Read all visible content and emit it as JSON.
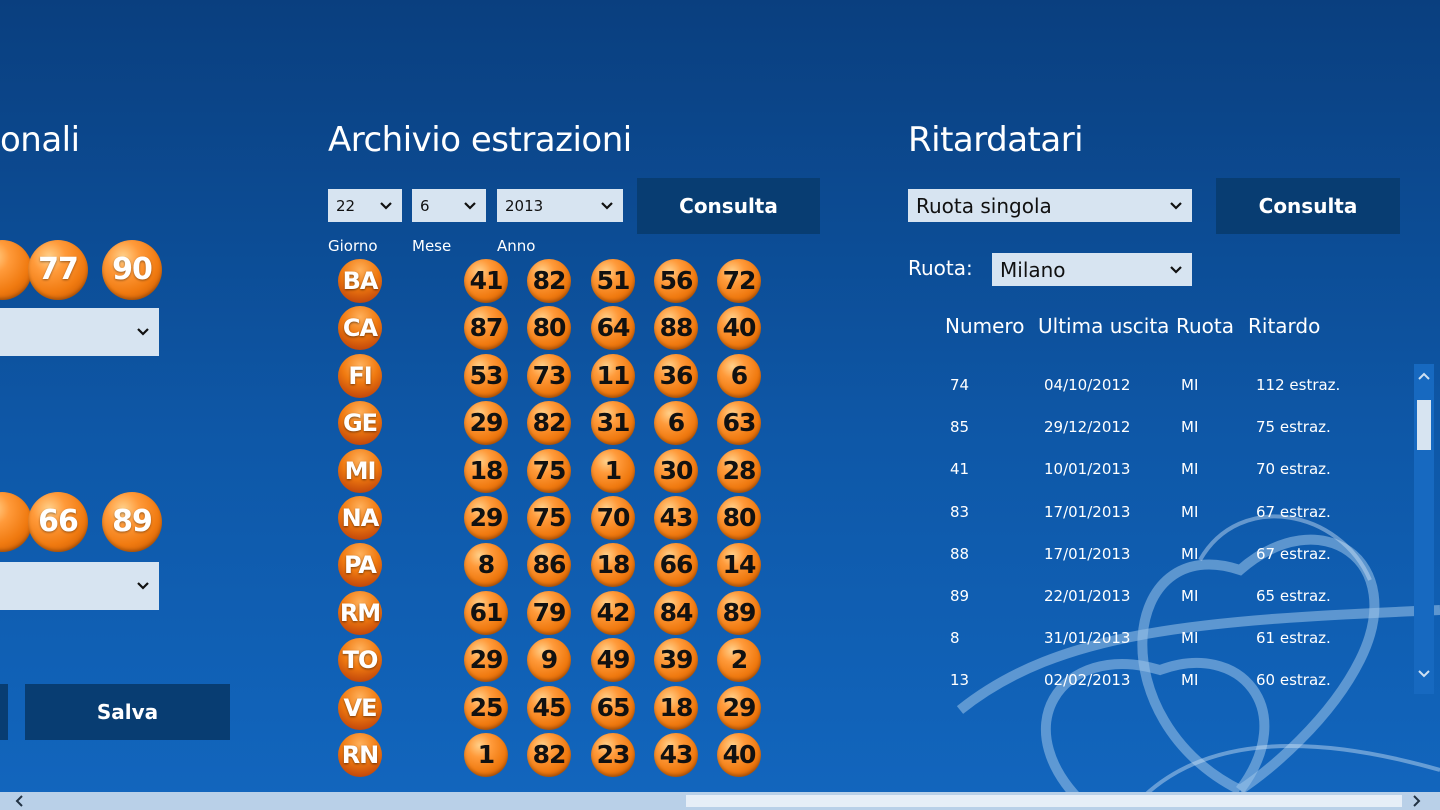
{
  "left": {
    "title_fragment": "onali",
    "balls_row1": [
      "77",
      "90"
    ],
    "balls_row2": [
      "66",
      "89"
    ],
    "salva_label": "Salva"
  },
  "archive": {
    "title": "Archivio estrazioni",
    "day": "22",
    "month": "6",
    "year": "2013",
    "consulta_label": "Consulta",
    "label_day": "Giorno",
    "label_month": "Mese",
    "label_year": "Anno",
    "rows": [
      {
        "city": "BA",
        "numbers": [
          "41",
          "82",
          "51",
          "56",
          "72"
        ]
      },
      {
        "city": "CA",
        "numbers": [
          "87",
          "80",
          "64",
          "88",
          "40"
        ]
      },
      {
        "city": "FI",
        "numbers": [
          "53",
          "73",
          "11",
          "36",
          "6"
        ]
      },
      {
        "city": "GE",
        "numbers": [
          "29",
          "82",
          "31",
          "6",
          "63"
        ]
      },
      {
        "city": "MI",
        "numbers": [
          "18",
          "75",
          "1",
          "30",
          "28"
        ]
      },
      {
        "city": "NA",
        "numbers": [
          "29",
          "75",
          "70",
          "43",
          "80"
        ]
      },
      {
        "city": "PA",
        "numbers": [
          "8",
          "86",
          "18",
          "66",
          "14"
        ]
      },
      {
        "city": "RM",
        "numbers": [
          "61",
          "79",
          "42",
          "84",
          "89"
        ]
      },
      {
        "city": "TO",
        "numbers": [
          "29",
          "9",
          "49",
          "39",
          "2"
        ]
      },
      {
        "city": "VE",
        "numbers": [
          "25",
          "45",
          "65",
          "18",
          "29"
        ]
      },
      {
        "city": "RN",
        "numbers": [
          "1",
          "82",
          "23",
          "43",
          "40"
        ]
      }
    ]
  },
  "ritardatari": {
    "title": "Ritardatari",
    "mode_value": "Ruota singola",
    "consulta_label": "Consulta",
    "ruota_label": "Ruota:",
    "ruota_value": "Milano",
    "headers": {
      "numero": "Numero",
      "ultima": "Ultima uscita",
      "ruota": "Ruota",
      "ritardo": "Ritardo"
    },
    "rows": [
      {
        "numero": "74",
        "ultima": "04/10/2012",
        "ruota": "MI",
        "ritardo": "112 estraz."
      },
      {
        "numero": "85",
        "ultima": "29/12/2012",
        "ruota": "MI",
        "ritardo": "75 estraz."
      },
      {
        "numero": "41",
        "ultima": "10/01/2013",
        "ruota": "MI",
        "ritardo": "70 estraz."
      },
      {
        "numero": "83",
        "ultima": "17/01/2013",
        "ruota": "MI",
        "ritardo": "67 estraz."
      },
      {
        "numero": "88",
        "ultima": "17/01/2013",
        "ruota": "MI",
        "ritardo": "67 estraz."
      },
      {
        "numero": "89",
        "ultima": "22/01/2013",
        "ruota": "MI",
        "ritardo": "65 estraz."
      },
      {
        "numero": "8",
        "ultima": "31/01/2013",
        "ruota": "MI",
        "ritardo": "61 estraz."
      },
      {
        "numero": "13",
        "ultima": "02/02/2013",
        "ruota": "MI",
        "ritardo": "60 estraz."
      }
    ]
  },
  "colors": {
    "accent": "#083d72",
    "ball": "#f07a10",
    "field": "#d7e4f1"
  }
}
